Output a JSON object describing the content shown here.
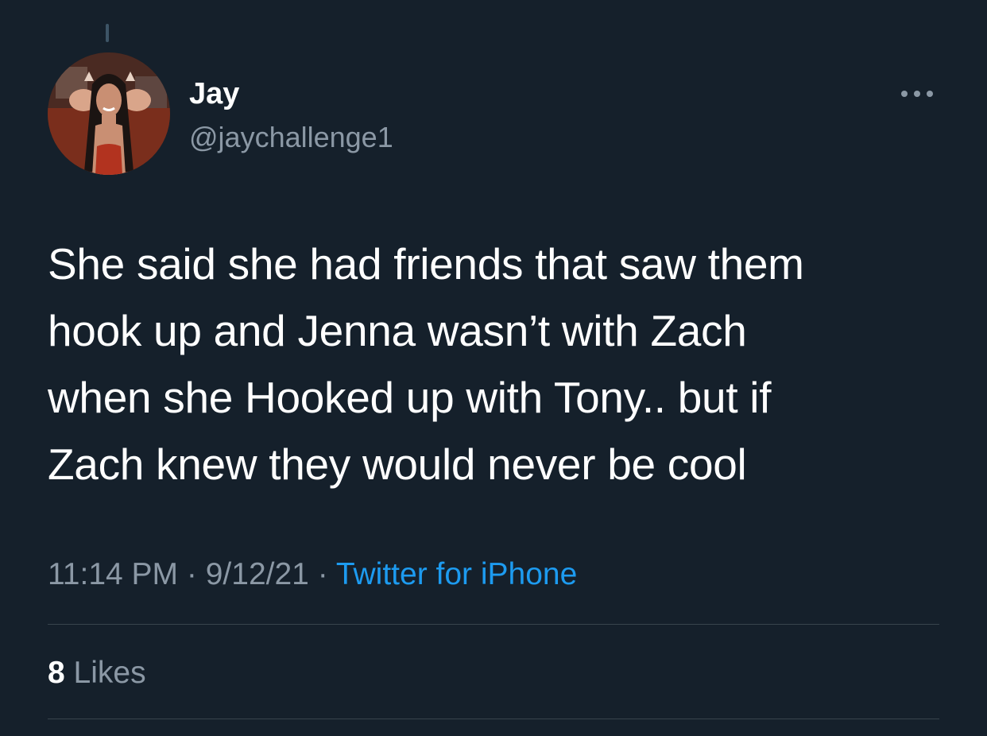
{
  "tweet": {
    "author": {
      "name": "Jay",
      "handle": "@jaychallenge1"
    },
    "more_icon": "more-horizontal-icon",
    "text_lines": [
      "She said she had friends that saw them",
      "hook up and Jenna wasn’t with Zach",
      "when she Hooked up with Tony.. but if",
      "Zach knew they would never be cool"
    ],
    "time": "11:14 PM",
    "separator": "·",
    "date": "9/12/21",
    "source": "Twitter for iPhone",
    "likes": {
      "count": "8",
      "label": "Likes"
    }
  },
  "colors": {
    "background": "#15202b",
    "text_primary": "#ffffff",
    "text_secondary": "#8b98a5",
    "link": "#1d9bf0",
    "divider": "#38444d"
  }
}
